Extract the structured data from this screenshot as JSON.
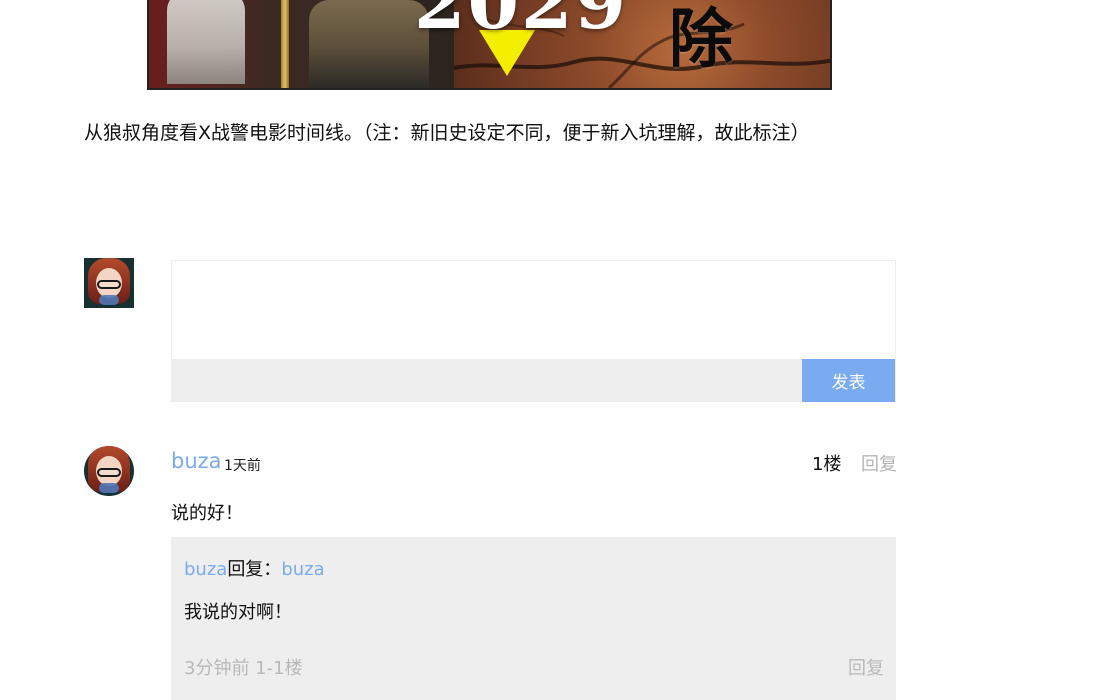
{
  "banner": {
    "year_text": "2029",
    "right_text": "除"
  },
  "caption": "从狼叔角度看X战警电影时间线。（注：新旧史设定不同，便于新入坑理解，故此标注）",
  "comment_form": {
    "textarea_value": "",
    "publish_label": "发表"
  },
  "comments": [
    {
      "user": "buza",
      "time": "1天前",
      "floor": "1楼",
      "reply_label": "回复",
      "content": "说的好！",
      "replies": [
        {
          "user": "buza",
          "sep": "回复：",
          "target": "buza",
          "content": "我说的对啊！",
          "meta": "3分钟前 1-1楼",
          "reply_label": "回复"
        }
      ]
    }
  ],
  "colors": {
    "accent_blue": "#7aaaf0",
    "panel_gray": "#eeeeee",
    "muted_gray": "#b9b9b9",
    "banner_marker_yellow": "#f4ef00"
  }
}
